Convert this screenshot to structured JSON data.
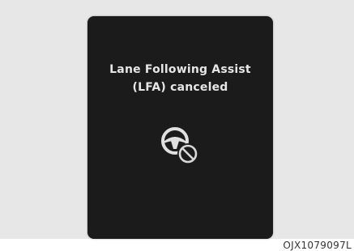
{
  "display": {
    "line1": "Lane Following Assist",
    "line2": "(LFA) canceled",
    "icon": "steering-wheel-cancel-icon"
  },
  "figure_code": "OJX1079097L",
  "colors": {
    "display_bg": "#1b1b1b",
    "text": "#e6e6e6",
    "icon": "#e0e0e0",
    "page_bg": "#e7e7e7"
  }
}
